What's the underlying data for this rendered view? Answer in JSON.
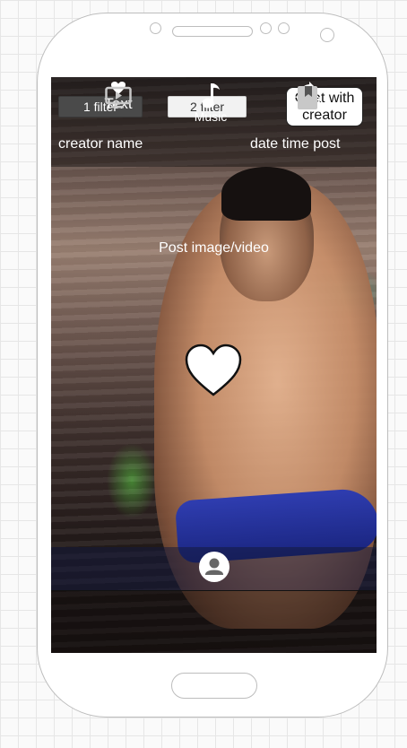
{
  "header": {
    "filter1_label": "1 filter",
    "filter2_label": "2 filter",
    "chat_label_line1": "Chat with",
    "chat_label_line2": "creator",
    "creator_name": "creator name",
    "date_time": "date time post"
  },
  "post": {
    "media_label": "Post image/video"
  },
  "actions": {
    "like_label": "Text",
    "share_label": "Text"
  },
  "nav": {
    "music_label": "Music",
    "active_item": "Music"
  },
  "icons": [
    "heart-icon",
    "profile-icon",
    "share-icon",
    "video-icon",
    "music-icon",
    "bookmark-icon"
  ]
}
